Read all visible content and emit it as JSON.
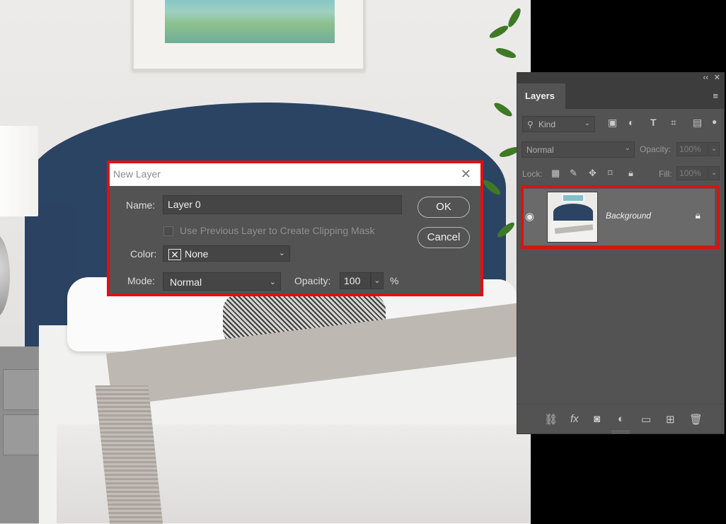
{
  "dialog": {
    "title": "New Layer",
    "close_glyph": "✕",
    "name_label": "Name:",
    "name_value": "Layer 0",
    "clipping_label": "Use Previous Layer to Create Clipping Mask",
    "clipping_checked": false,
    "color_label": "Color:",
    "color_value": "None",
    "mode_label": "Mode:",
    "mode_value": "Normal",
    "opacity_label": "Opacity:",
    "opacity_value": "100",
    "percent": "%",
    "ok_label": "OK",
    "cancel_label": "Cancel"
  },
  "layers_panel": {
    "collapse_glyph": "‹‹",
    "close_glyph": "✕",
    "tab_label": "Layers",
    "menu_glyph": "≡",
    "filter_value": "Kind",
    "blend_value": "Normal",
    "opacity_label": "Opacity:",
    "opacity_value": "100%",
    "lock_label": "Lock:",
    "fill_label": "Fill:",
    "fill_value": "100%",
    "layers": [
      {
        "name": "Background",
        "visible": true,
        "locked": true
      }
    ]
  },
  "highlight_color": "#e01010"
}
